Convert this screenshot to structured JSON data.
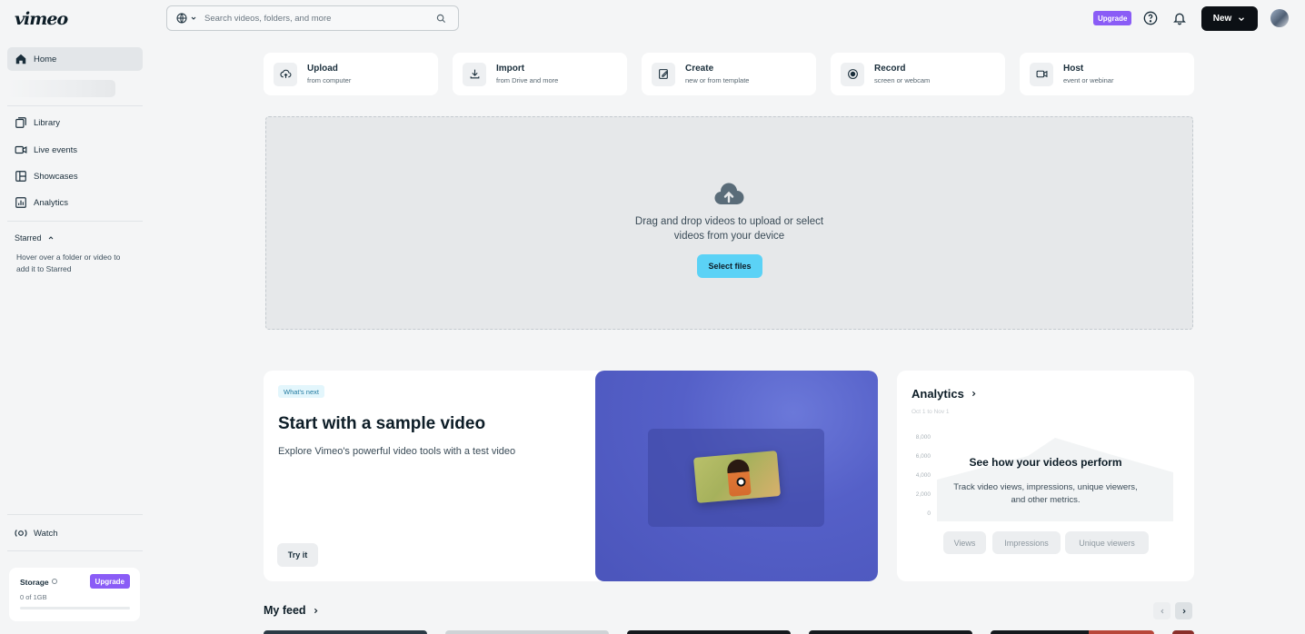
{
  "app": {
    "logo": "vimeo"
  },
  "search": {
    "placeholder": "Search videos, folders, and more"
  },
  "header": {
    "upgrade_label": "Upgrade",
    "new_label": "New"
  },
  "sidebar": {
    "home": "Home",
    "library": "Library",
    "live_events": "Live events",
    "showcases": "Showcases",
    "analytics": "Analytics",
    "starred_title": "Starred",
    "starred_hint": "Hover over a folder or video to add it to Starred",
    "watch": "Watch",
    "storage": {
      "label": "Storage",
      "upgrade_label": "Upgrade",
      "used": "0 of 1GB",
      "fraction_used": 0
    }
  },
  "actions": [
    {
      "title": "Upload",
      "subtitle": "from computer"
    },
    {
      "title": "Import",
      "subtitle": "from Drive and more"
    },
    {
      "title": "Create",
      "subtitle": "new or from template"
    },
    {
      "title": "Record",
      "subtitle": "screen or webcam"
    },
    {
      "title": "Host",
      "subtitle": "event or webinar"
    }
  ],
  "dropzone": {
    "line1": "Drag and drop videos to upload or select",
    "line2": "videos from your device",
    "button": "Select files"
  },
  "sample": {
    "badge": "What's next",
    "title": "Start with a sample video",
    "description": "Explore Vimeo's powerful video tools with a test video",
    "button": "Try it"
  },
  "analytics": {
    "title": "Analytics",
    "date_range": "Oct 1 to Nov 1",
    "y_ticks": [
      "8,000",
      "6,000",
      "4,000",
      "2,000",
      "0"
    ],
    "heading": "See how your videos perform",
    "subtitle": "Track video views, impressions, unique viewers, and other metrics.",
    "tabs": [
      "Views",
      "Impressions",
      "Unique viewers"
    ]
  },
  "feed": {
    "title": "My feed"
  },
  "colors": {
    "accent_purple": "#8a5cf6",
    "accent_cyan": "#5bd2f6",
    "dark_button": "#0c1015"
  }
}
